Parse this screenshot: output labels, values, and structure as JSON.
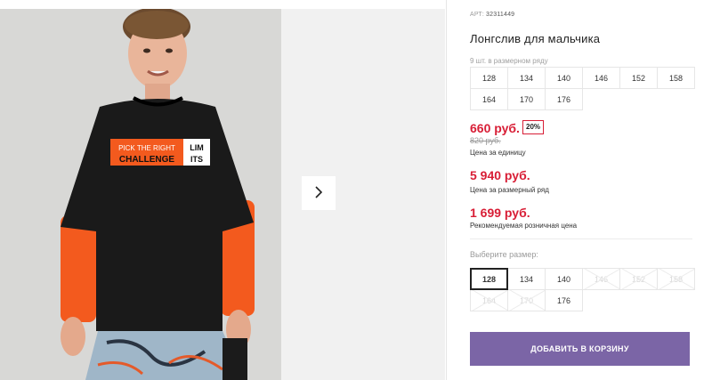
{
  "product": {
    "article_label": "АРТ:",
    "article_value": "32311449",
    "title": "Лонгслив для мальчика",
    "size_row_label": "9 шт. в размерном ряду",
    "size_row": [
      "128",
      "134",
      "140",
      "146",
      "152",
      "158",
      "164",
      "170",
      "176"
    ],
    "price": "660 руб.",
    "discount": "20%",
    "old_price": "820 руб.",
    "unit_label": "Цена за единицу",
    "row_price": "5 940 руб.",
    "row_label": "Цена за размерный ряд",
    "rrp": "1 699 руб.",
    "rrp_label": "Рекомендуемая розничная цена"
  },
  "size_picker": {
    "label": "Выберите размер:",
    "sizes": [
      {
        "label": "128",
        "state": "selected"
      },
      {
        "label": "134",
        "state": "available"
      },
      {
        "label": "140",
        "state": "available"
      },
      {
        "label": "146",
        "state": "disabled"
      },
      {
        "label": "152",
        "state": "disabled"
      },
      {
        "label": "158",
        "state": "disabled"
      },
      {
        "label": "164",
        "state": "disabled"
      },
      {
        "label": "170",
        "state": "disabled"
      },
      {
        "label": "176",
        "state": "available"
      }
    ]
  },
  "actions": {
    "add_to_cart": "ДОБАВИТЬ В КОРЗИНУ",
    "next_icon": "chevron-right-icon"
  },
  "print": {
    "line1": "PICK THE RIGHT",
    "line2": "CHALLENGE",
    "box1": "LIM",
    "box2": "ITS"
  },
  "colors": {
    "price_red": "#d81e36",
    "button_purple": "#7b65a6"
  }
}
